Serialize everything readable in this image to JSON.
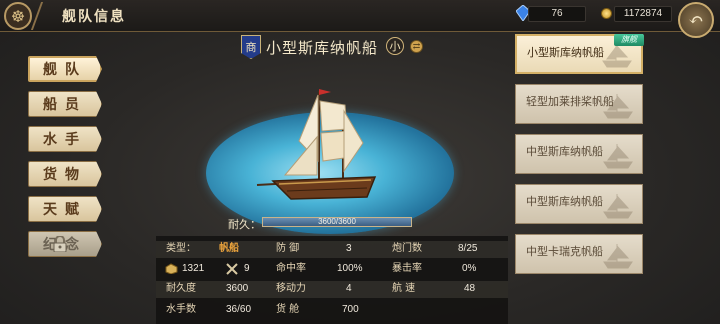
{
  "header": {
    "title": "舰队信息"
  },
  "resources": {
    "gems": "76",
    "gold": "1172874"
  },
  "menu": [
    {
      "label": "舰队",
      "active": true
    },
    {
      "label": "船员"
    },
    {
      "label": "水手"
    },
    {
      "label": "货物"
    },
    {
      "label": "天赋"
    },
    {
      "label": "纪念",
      "locked": true
    }
  ],
  "ship": {
    "rank": "商",
    "name": "小型斯库纳帆船",
    "size": "小",
    "durability_label": "耐久：",
    "durability_text": "3600/3600",
    "durability_fraction": 1.0
  },
  "stats": {
    "type_label": "类型：",
    "type_value": "帆船",
    "capacity_value": "1321",
    "cannon_count_value": "9",
    "durability_label": "耐久度",
    "durability_value": "3600",
    "sailors_label": "水手数",
    "sailors_value": "36/60",
    "defense_label": "防  御",
    "defense_value": "3",
    "accuracy_label": "命中率",
    "accuracy_value": "100%",
    "mobility_label": "移动力",
    "mobility_value": "4",
    "cargo_label": "货  舱",
    "cargo_value": "700",
    "gunports_label": "炮门数",
    "gunports_value": "8/25",
    "crit_label": "暴击率",
    "crit_value": "0%",
    "speed_label": "航  速",
    "speed_value": "48"
  },
  "ship_list": [
    {
      "name": "小型斯库纳帆船",
      "active": true,
      "badge": "旗舰"
    },
    {
      "name": "轻型加莱排桨帆船"
    },
    {
      "name": "中型斯库纳帆船"
    },
    {
      "name": "中型斯库纳帆船"
    },
    {
      "name": "中型卡瑞克帆船"
    }
  ],
  "colors": {
    "accent_gold": "#caa45e",
    "highlight_orange": "#e9a23c",
    "flag_green": "#1f8a64"
  }
}
